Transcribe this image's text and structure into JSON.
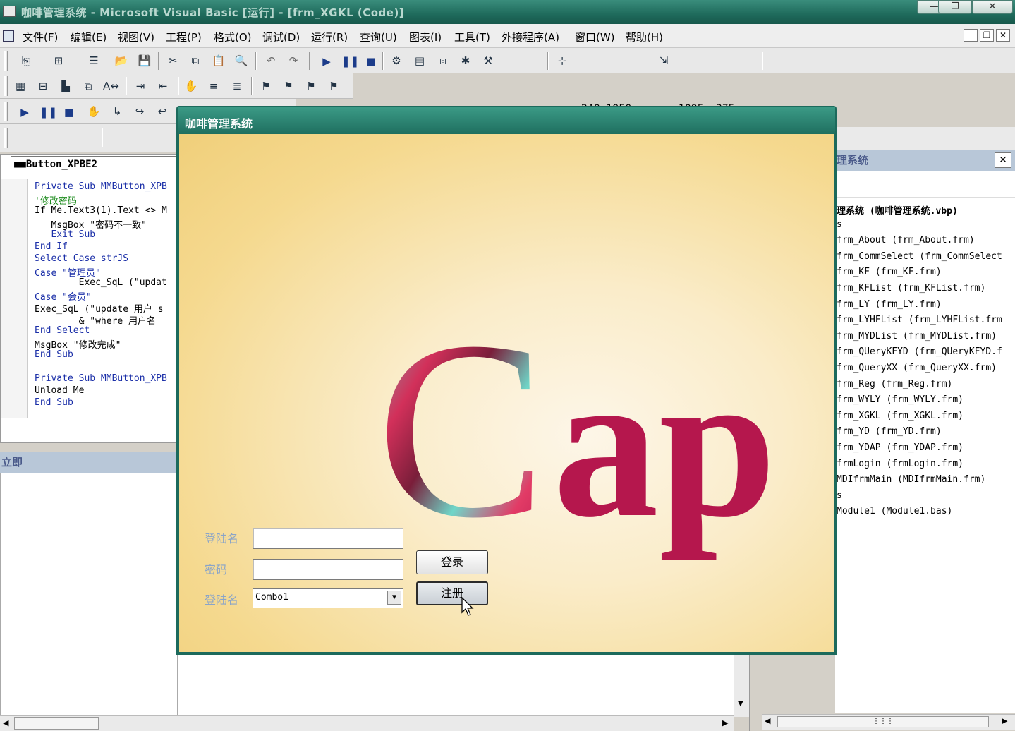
{
  "ide": {
    "title": "咖啡管理系统 - Microsoft Visual Basic [运行] - [frm_XGKL (Code)]",
    "window_controls": {
      "minimize": "—",
      "restore": "❐",
      "close": "✕"
    },
    "menus": [
      "文件(F)",
      "编辑(E)",
      "视图(V)",
      "工程(P)",
      "格式(O)",
      "调试(D)",
      "运行(R)",
      "查询(U)",
      "图表(I)",
      "工具(T)",
      "外接程序(A)",
      "窗口(W)",
      "帮助(H)"
    ],
    "mdi_controls": {
      "minimize": "_",
      "restore": "❐",
      "close": "✕"
    },
    "position_readout": "240, 1950",
    "size_readout": "1095 x 375"
  },
  "code_window": {
    "object_combo": "■■Button_XPBE2",
    "lines": [
      {
        "text": "Private Sub MMButton_XPB",
        "style": "kw"
      },
      {
        "text": "'修改密码",
        "style": "cm"
      },
      {
        "text": "If Me.Text3(1).Text <> M",
        "style": "plain"
      },
      {
        "text": "   MsgBox \"密码不一致\"",
        "style": "plain"
      },
      {
        "text": "   Exit Sub",
        "style": "kw"
      },
      {
        "text": "End If",
        "style": "kw"
      },
      {
        "text": "Select Case strJS",
        "style": "kw"
      },
      {
        "text": "Case \"管理员\"",
        "style": "kw"
      },
      {
        "text": "        Exec_SqL (\"updat",
        "style": "plain"
      },
      {
        "text": "Case \"会员\"",
        "style": "kw"
      },
      {
        "text": "Exec_SqL (\"update 用户 s",
        "style": "plain"
      },
      {
        "text": "        & \"where 用户名",
        "style": "plain"
      },
      {
        "text": "End Select",
        "style": "kw"
      },
      {
        "text": "MsgBox \"修改完成\"",
        "style": "plain"
      },
      {
        "text": "End Sub",
        "style": "kw"
      },
      {
        "text": "",
        "style": "plain"
      },
      {
        "text": "Private Sub MMButton_XPB",
        "style": "kw"
      },
      {
        "text": "Unload Me",
        "style": "plain"
      },
      {
        "text": "End Sub",
        "style": "kw"
      }
    ]
  },
  "immediate": {
    "title": "立即"
  },
  "project_explorer": {
    "title": "理系统",
    "close": "✕",
    "items": [
      "理系统 (咖啡管理系统.vbp)",
      "s",
      "frm_About (frm_About.frm)",
      "frm_CommSelect (frm_CommSelect",
      "frm_KF (frm_KF.frm)",
      "frm_KFList (frm_KFList.frm)",
      "frm_LY (frm_LY.frm)",
      "frm_LYHFList (frm_LYHFList.frm",
      "frm_MYDList (frm_MYDList.frm)",
      "frm_QUeryKFYD (frm_QUeryKFYD.f",
      "frm_QueryXX (frm_QueryXX.frm)",
      "frm_Reg (frm_Reg.frm)",
      "frm_WYLY (frm_WYLY.frm)",
      "frm_XGKL (frm_XGKL.frm)",
      "frm_YD (frm_YD.frm)",
      "frm_YDAP (frm_YDAP.frm)",
      "frmLogin (frmLogin.frm)",
      "MDIfrmMain (MDIfrmMain.frm)",
      "s",
      "Module1 (Module1.bas)"
    ]
  },
  "login_form": {
    "title": "咖啡管理系统",
    "logo_text": "Cap",
    "username_label": "登陆名",
    "username_value": "",
    "password_label": "密码",
    "password_value": "",
    "role_label": "登陆名",
    "role_value": "Combo1",
    "login_button": "登录",
    "register_button": "注册"
  },
  "colors": {
    "ide_title_bg": "#1f6b5c",
    "label_blue": "#8aa4c8",
    "logo_crimson": "#b5174d",
    "logo_teal": "#5fd0c4"
  }
}
